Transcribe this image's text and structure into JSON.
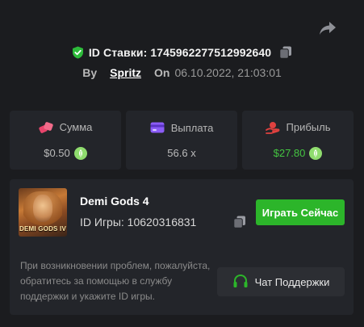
{
  "header": {
    "bet_id_label": "ID Ставки: 1745962277512992640",
    "by_label": "By",
    "username": "Spritz",
    "on_label": "On",
    "date": "06.10.2022, 21:03:01",
    "icons": {
      "verified": "shield-check-icon",
      "copy": "copy-icon",
      "share": "share-arrow-icon"
    }
  },
  "stats": [
    {
      "label": "Сумма",
      "value": "$0.50",
      "icon": "bet-chips-icon",
      "icon_color": "#e8456c",
      "coin": true
    },
    {
      "label": "Выплата",
      "value": "56.6 x",
      "icon": "wallet-card-icon",
      "icon_color": "#8b5cf6",
      "coin": false
    },
    {
      "label": "Прибыль",
      "value": "$27.80",
      "icon": "profit-hand-icon",
      "icon_color": "#e0413f",
      "coin": true,
      "value_color": "#44c441"
    }
  ],
  "game": {
    "title": "Demi Gods 4",
    "id_label": "ID Игры: 10620316831",
    "thumbnail_text": "DEMI GODS IV",
    "play_button": "Играть Сейчас"
  },
  "support": {
    "help_text": "При возникновении проблем, пожалуйста, обратитесь за помощью в службу поддержки и укажите ID игры.",
    "button_label": "Чат Поддержки"
  },
  "colors": {
    "background": "#1b1c1f",
    "card": "#23252a",
    "accent_green": "#2cb52a",
    "coin_green": "#8fdc6e"
  }
}
